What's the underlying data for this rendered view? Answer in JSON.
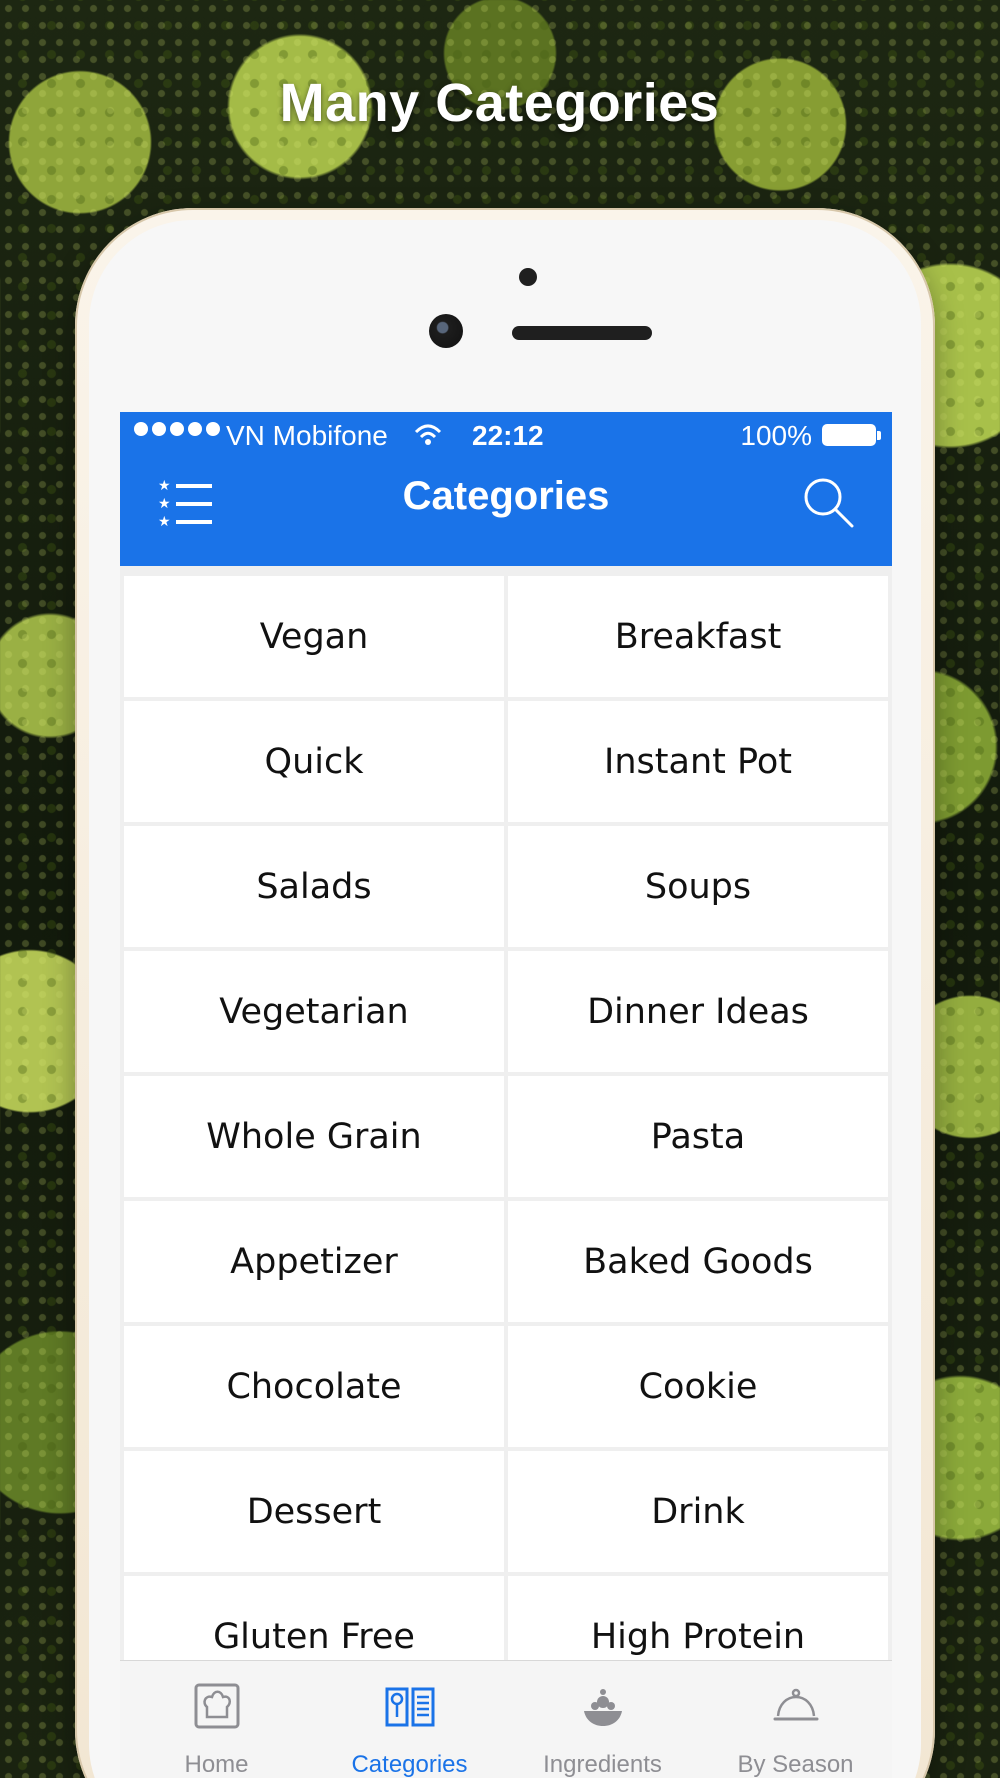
{
  "headline": "Many Categories",
  "status": {
    "carrier": "VN Mobifone",
    "time": "22:12",
    "battery": "100%"
  },
  "navbar": {
    "title": "Categories",
    "left_icon": "menu-list-icon",
    "right_icon": "search-icon"
  },
  "categories": [
    "Vegan",
    "Breakfast",
    "Quick",
    "Instant Pot",
    "Salads",
    "Soups",
    "Vegetarian",
    "Dinner Ideas",
    "Whole Grain",
    "Pasta",
    "Appetizer",
    "Baked Goods",
    "Chocolate",
    "Cookie",
    "Dessert",
    "Drink",
    "Gluten Free",
    "High Protein"
  ],
  "tabs": [
    {
      "label": "Home",
      "icon": "home-chef-icon"
    },
    {
      "label": "Categories",
      "icon": "recipe-book-icon"
    },
    {
      "label": "Ingredients",
      "icon": "ingredients-icon"
    },
    {
      "label": "By Season",
      "icon": "cloche-icon"
    }
  ],
  "colors": {
    "accent": "#1a73e8",
    "tab_inactive": "#8e8e93"
  }
}
